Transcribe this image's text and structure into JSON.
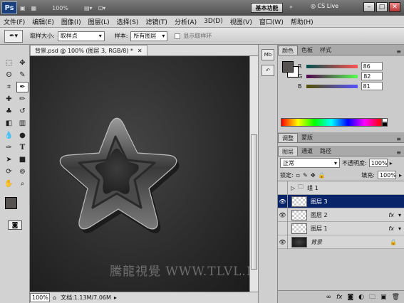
{
  "titlebar": {
    "logo": "Ps",
    "controls": [
      "100%"
    ],
    "workspace": "基本功能",
    "cslive": "CS Live"
  },
  "menu": [
    "文件(F)",
    "编辑(E)",
    "图像(I)",
    "图层(L)",
    "选择(S)",
    "滤镜(T)",
    "分析(A)",
    "3D(D)",
    "视图(V)",
    "窗口(W)",
    "帮助(H)"
  ],
  "options": {
    "sample_size_label": "取样大小:",
    "sample_size_value": "取样点",
    "sample_label": "样本:",
    "sample_value": "所有图层",
    "show_ring_label": "显示取样环"
  },
  "document": {
    "tab_title": "背景.psd @ 100% (图层 3, RGB/8) *",
    "zoom": "100%",
    "doc_info": "文档:1.13M/7.06M"
  },
  "watermark": "騰龍視覺 WWW.TLVL.NET",
  "color_panel": {
    "tabs": [
      "颜色",
      "色板",
      "样式"
    ],
    "channels": [
      {
        "name": "R",
        "value": "86"
      },
      {
        "name": "G",
        "value": "82"
      },
      {
        "name": "B",
        "value": "81"
      }
    ],
    "foreground": "#565251"
  },
  "adjust_tabs": [
    "调整",
    "蒙版"
  ],
  "layers_panel": {
    "tabs": [
      "图层",
      "通道",
      "路径"
    ],
    "blend_mode": "正常",
    "opacity_label": "不透明度:",
    "opacity": "100%",
    "lock_label": "锁定:",
    "fill_label": "填充:",
    "fill": "100%",
    "layers": [
      {
        "name": "组 1",
        "type": "group",
        "visible": false,
        "selected": false,
        "fx": false
      },
      {
        "name": "图层 3",
        "type": "layer",
        "visible": true,
        "selected": true,
        "fx": false
      },
      {
        "name": "图层 2",
        "type": "layer",
        "visible": true,
        "selected": false,
        "fx": true
      },
      {
        "name": "图层 1",
        "type": "layer",
        "visible": false,
        "selected": false,
        "fx": true
      },
      {
        "name": "背景",
        "type": "background",
        "visible": true,
        "selected": false,
        "fx": false
      }
    ],
    "fx_label": "fx"
  }
}
